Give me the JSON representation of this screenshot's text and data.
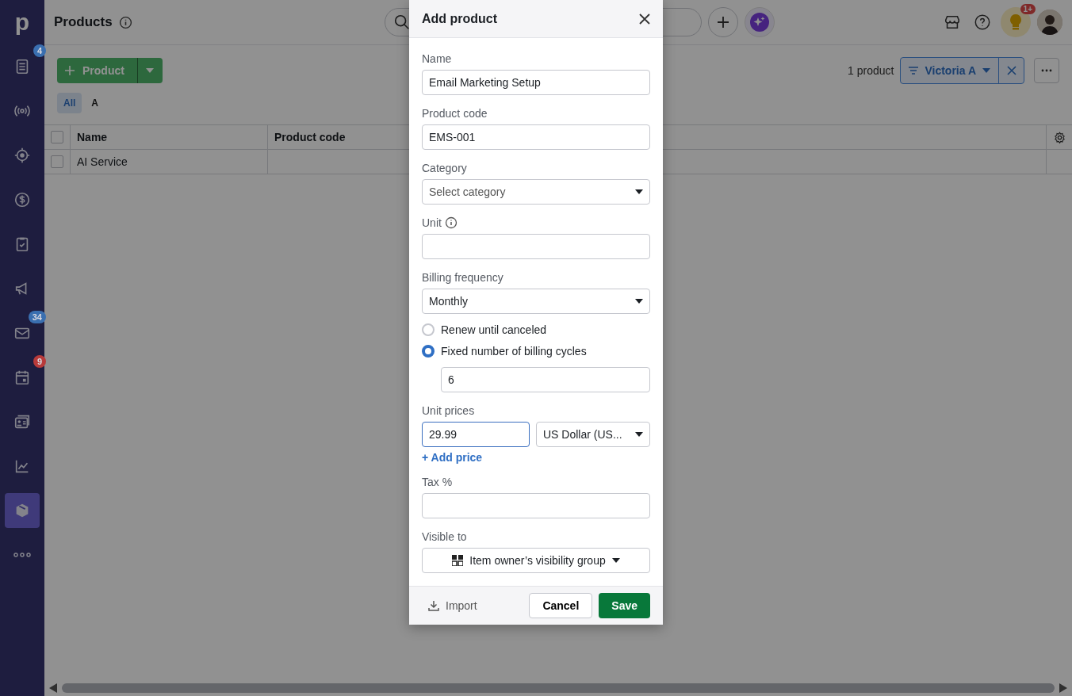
{
  "sidebar": {
    "logo": "p",
    "items": [
      {
        "kind": "list",
        "badge": "4",
        "color": "#3a6fb0",
        "selected": false
      },
      {
        "kind": "broadcast",
        "selected": false
      },
      {
        "kind": "target",
        "selected": false
      },
      {
        "kind": "dollar",
        "selected": false
      },
      {
        "kind": "clipboard",
        "selected": false
      },
      {
        "kind": "megaphone",
        "selected": false
      },
      {
        "kind": "mail",
        "badge": "34",
        "color": "#3a6fb0",
        "selected": false
      },
      {
        "kind": "calendar",
        "badge": "9",
        "color": "#b83a3a",
        "selected": false
      },
      {
        "kind": "contact",
        "selected": false
      },
      {
        "kind": "chart",
        "selected": false
      },
      {
        "kind": "box",
        "selected": true
      },
      {
        "kind": "more",
        "selected": false
      }
    ]
  },
  "header": {
    "title": "Products",
    "tips_badge": "1+"
  },
  "toolbar": {
    "add_button": "Product",
    "count": "1 product",
    "filter": "Victoria A"
  },
  "tabs": [
    {
      "label": "All",
      "selected": true
    },
    {
      "label": "A",
      "selected": false
    }
  ],
  "table": {
    "header_checked": false,
    "columns": [
      "Name",
      "Product code"
    ],
    "rows": [
      {
        "name": "AI Service",
        "checked": false
      }
    ]
  },
  "modal": {
    "title": "Add product",
    "fields": [
      {
        "kind": "text",
        "label": "Name",
        "value": "Email Marketing Setup"
      },
      {
        "kind": "text",
        "label": "Product code",
        "value": "EMS-001"
      },
      {
        "kind": "select",
        "label": "Category",
        "placeholder": "Select category"
      },
      {
        "kind": "text",
        "label": "Unit",
        "info": true
      },
      {
        "kind": "select",
        "label": "Billing frequency",
        "value": "Monthly"
      },
      {
        "kind": "radio",
        "label": "Renew until canceled",
        "selected": false
      },
      {
        "kind": "radio",
        "label": "Fixed number of billing cycles",
        "selected": true
      },
      {
        "kind": "indented",
        "value": "6"
      },
      {
        "kind": "price",
        "label": "Unit prices",
        "value": "29.99",
        "currency": "US Dollar (US...",
        "focused": true
      },
      {
        "kind": "link",
        "label": "+ Add price"
      },
      {
        "kind": "text",
        "label": "Tax %"
      },
      {
        "kind": "visibility",
        "label": "Visible to",
        "value": "Item owner’s visibility group"
      }
    ],
    "footer": {
      "import": "Import",
      "cancel": "Cancel",
      "save": "Save"
    }
  }
}
